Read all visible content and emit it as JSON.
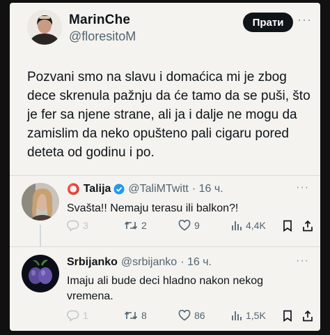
{
  "main_tweet": {
    "author_name": "MarinChe",
    "author_handle": "@floresitoM",
    "follow_label": "Прати",
    "more_label": "···",
    "text": "Pozvani smo na slavu i domaćica mi je zbog dece skrenula pažnju da će tamo da se puši, što je fer sa njene strane, ali ja i dalje ne mogu da zamislim da neko opušteno pali cigaru pored deteta od godinu i po."
  },
  "replies": [
    {
      "name_prefix": "⭕",
      "name": "Talija",
      "verified": true,
      "handle": "@TaliMTwitt",
      "time": "· 16 ч.",
      "more_label": "···",
      "text": "Svašta!! Nemaju terasu ili balkon?!",
      "reply_count": "3",
      "retweets": "2",
      "likes": "9",
      "views": "4,4K"
    },
    {
      "name": "Srbijanko",
      "handle": "@srbijanko",
      "time": "· 16 ч.",
      "more_label": "···",
      "text": "Imaju ali bude deci hladno nakon nekog vremena.",
      "reply_count": "1",
      "retweets": "8",
      "likes": "86",
      "views": "1,5K"
    }
  ],
  "colors": {
    "card_bg": "#f4f3ef",
    "text": "#0f1419",
    "muted": "#536471",
    "verified": "#1d9bf0",
    "circle_red": "#e0245e"
  }
}
